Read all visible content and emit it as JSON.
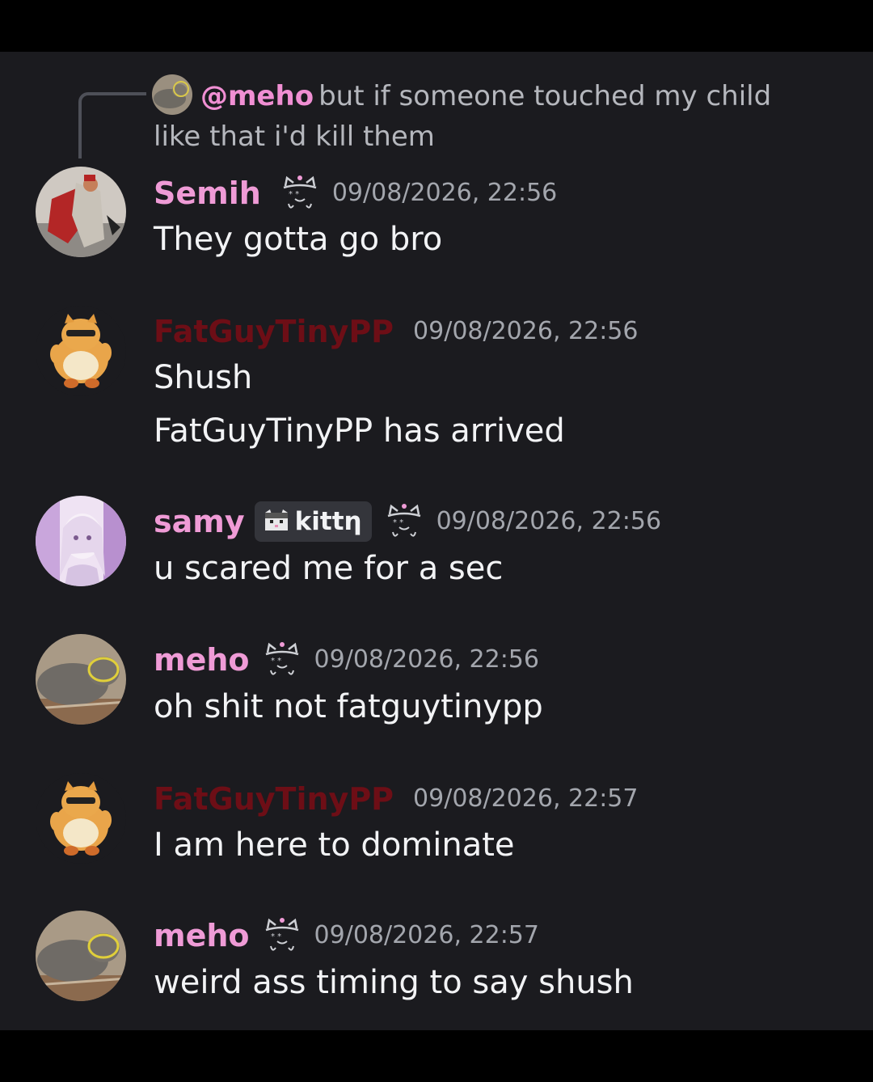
{
  "reply": {
    "mention": "@meho",
    "text": "but if someone touched my child like that i'd kill them"
  },
  "messages": [
    {
      "username": "Semih",
      "timestamp": "09/08/2026, 22:56",
      "lines": [
        "They gotta go bro"
      ],
      "badge_icon": "cat-face-icon",
      "name_color": "#ef9bd6"
    },
    {
      "username": "FatGuyTinyPP",
      "timestamp": "09/08/2026, 22:56",
      "lines": [
        "Shush",
        "FatGuyTinyPP has arrived"
      ],
      "name_color": "#6d0e16"
    },
    {
      "username": "samy",
      "tag": "kittη",
      "timestamp": "09/08/2026, 22:56",
      "lines": [
        "u scared me for a sec"
      ],
      "badge_icon": "cat-face-icon",
      "name_color": "#ef9bd6"
    },
    {
      "username": "meho",
      "timestamp": "09/08/2026, 22:56",
      "lines": [
        "oh shit not fatguytinypp"
      ],
      "badge_icon": "cat-face-icon",
      "name_color": "#ef9bd6"
    },
    {
      "username": "FatGuyTinyPP",
      "timestamp": "09/08/2026, 22:57",
      "lines": [
        "I am here to dominate"
      ],
      "name_color": "#6d0e16"
    },
    {
      "username": "meho",
      "timestamp": "09/08/2026, 22:57",
      "lines": [
        "weird ass timing to say shush"
      ],
      "badge_icon": "cat-face-icon",
      "name_color": "#ef9bd6"
    }
  ]
}
